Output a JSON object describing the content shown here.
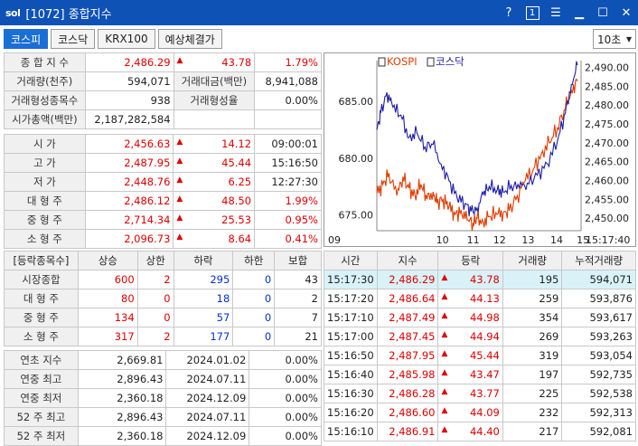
{
  "window": {
    "logo": "sol",
    "title": "[1072] 종합지수",
    "help": "?",
    "num": "1"
  },
  "tabs": [
    "코스피",
    "코스닥",
    "KRX100",
    "예상체결가"
  ],
  "interval": "10초",
  "summary": {
    "r1": [
      "종 합 지 수",
      "2,486.29",
      "▲",
      "43.78",
      "1.79%"
    ],
    "r2": [
      "거래량(천주)",
      "594,071",
      "거래대금(백만)",
      "8,941,088"
    ],
    "r3": [
      "거래형성종목수",
      "938",
      "거래형성율",
      "0.00%"
    ],
    "r4": [
      "시가총액(백만)",
      "2,187,282,584"
    ]
  },
  "prices": [
    [
      "시    가",
      "2,456.63",
      "▲",
      "14.12",
      "09:00:01"
    ],
    [
      "고    가",
      "2,487.95",
      "▲",
      "45.44",
      "15:16:50"
    ],
    [
      "저    가",
      "2,448.76",
      "▲",
      "6.25",
      "12:27:30"
    ],
    [
      "대 형 주",
      "2,486.12",
      "▲",
      "48.50",
      "1.99%"
    ],
    [
      "중 형 주",
      "2,714.34",
      "▲",
      "25.53",
      "0.95%"
    ],
    [
      "소 형 주",
      "2,096.73",
      "▲",
      "8.64",
      "0.41%"
    ]
  ],
  "breadth": {
    "headers": [
      "[등락종목수]",
      "상승",
      "상한",
      "하락",
      "하한",
      "보합"
    ],
    "rows": [
      [
        "시장종합",
        "600",
        "2",
        "295",
        "0",
        "43"
      ],
      [
        "대 형 주",
        "80",
        "0",
        "18",
        "0",
        "2"
      ],
      [
        "중 형 주",
        "134",
        "0",
        "57",
        "0",
        "7"
      ],
      [
        "소 형 주",
        "317",
        "2",
        "177",
        "0",
        "21"
      ]
    ]
  },
  "yearly": [
    [
      "연초 지수",
      "2,669.81",
      "2024.01.02",
      "0.00%"
    ],
    [
      "연중 최고",
      "2,896.43",
      "2024.07.11",
      "0.00%"
    ],
    [
      "연중 최저",
      "2,360.18",
      "2024.12.09",
      "0.00%"
    ],
    [
      "52 주 최고",
      "2,896.43",
      "2024.07.11",
      "0.00%"
    ],
    [
      "52 주 최저",
      "2,360.18",
      "2024.12.09",
      "0.00%"
    ]
  ],
  "ticks": {
    "headers": [
      "시간",
      "지수",
      "등락",
      "거래량",
      "누적거래량"
    ],
    "rows": [
      [
        "15:17:30",
        "2,486.29",
        "▲",
        "43.78",
        "195",
        "594,071"
      ],
      [
        "15:17:20",
        "2,486.64",
        "▲",
        "44.13",
        "259",
        "593,876"
      ],
      [
        "15:17:10",
        "2,487.49",
        "▲",
        "44.98",
        "354",
        "593,617"
      ],
      [
        "15:17:00",
        "2,487.45",
        "▲",
        "44.94",
        "269",
        "593,263"
      ],
      [
        "15:16:50",
        "2,487.95",
        "▲",
        "45.44",
        "319",
        "593,054"
      ],
      [
        "15:16:40",
        "2,485.98",
        "▲",
        "43.47",
        "197",
        "592,735"
      ],
      [
        "15:16:30",
        "2,486.28",
        "▲",
        "43.77",
        "225",
        "592,538"
      ],
      [
        "15:16:20",
        "2,486.60",
        "▲",
        "44.09",
        "232",
        "592,313"
      ],
      [
        "15:16:10",
        "2,486.91",
        "▲",
        "44.40",
        "217",
        "592,081"
      ]
    ]
  },
  "chart_data": {
    "type": "line",
    "legend": [
      "KOSPI",
      "코스닥"
    ],
    "x_ticks": [
      "09",
      "10",
      "11",
      "12",
      "13",
      "14",
      "15",
      "15:17:40"
    ],
    "left_axis": [
      "685.00",
      "680.00",
      "675.00"
    ],
    "right_axis": [
      "2,490.00",
      "2,485.00",
      "2,480.00",
      "2,475.00",
      "2,470.00",
      "2,465.00",
      "2,460.00",
      "2,455.00",
      "2,450.00"
    ],
    "left_range": [
      673.6,
      688.6
    ],
    "right_range": [
      2446.7,
      2491.8
    ],
    "series": [
      {
        "name": "KOSPI",
        "axis": "right",
        "color": "#e03c00",
        "points": [
          [
            0,
            2456.6
          ],
          [
            0.03,
            2459
          ],
          [
            0.06,
            2462
          ],
          [
            0.1,
            2456
          ],
          [
            0.13,
            2461
          ],
          [
            0.16,
            2458
          ],
          [
            0.19,
            2456
          ],
          [
            0.22,
            2459
          ],
          [
            0.25,
            2455
          ],
          [
            0.28,
            2457
          ],
          [
            0.3,
            2454
          ],
          [
            0.33,
            2455
          ],
          [
            0.36,
            2453
          ],
          [
            0.39,
            2451
          ],
          [
            0.42,
            2452
          ],
          [
            0.45,
            2449.5
          ],
          [
            0.48,
            2448.8
          ],
          [
            0.5,
            2450
          ],
          [
            0.53,
            2449
          ],
          [
            0.56,
            2450.5
          ],
          [
            0.6,
            2451
          ],
          [
            0.63,
            2451.5
          ],
          [
            0.66,
            2452
          ],
          [
            0.7,
            2456
          ],
          [
            0.74,
            2460
          ],
          [
            0.78,
            2463
          ],
          [
            0.82,
            2467
          ],
          [
            0.86,
            2470
          ],
          [
            0.9,
            2474
          ],
          [
            0.94,
            2479
          ],
          [
            0.97,
            2484
          ],
          [
            1.0,
            2486.3
          ]
        ]
      },
      {
        "name": "코스닥",
        "axis": "left",
        "color": "#1c1caa",
        "points": [
          [
            0,
            682.5
          ],
          [
            0.02,
            684
          ],
          [
            0.05,
            685.8
          ],
          [
            0.08,
            684.5
          ],
          [
            0.12,
            683.8
          ],
          [
            0.16,
            681.8
          ],
          [
            0.2,
            682.2
          ],
          [
            0.24,
            681
          ],
          [
            0.28,
            681.2
          ],
          [
            0.32,
            679.5
          ],
          [
            0.36,
            678
          ],
          [
            0.4,
            676.5
          ],
          [
            0.44,
            676
          ],
          [
            0.47,
            675.3
          ],
          [
            0.5,
            675.6
          ],
          [
            0.53,
            676.8
          ],
          [
            0.56,
            677.5
          ],
          [
            0.6,
            677.2
          ],
          [
            0.63,
            677
          ],
          [
            0.67,
            677.6
          ],
          [
            0.71,
            677.4
          ],
          [
            0.75,
            677.8
          ],
          [
            0.8,
            678.5
          ],
          [
            0.85,
            679.5
          ],
          [
            0.9,
            681.5
          ],
          [
            0.94,
            684
          ],
          [
            0.97,
            686.5
          ],
          [
            1.0,
            688.2
          ]
        ]
      }
    ]
  }
}
